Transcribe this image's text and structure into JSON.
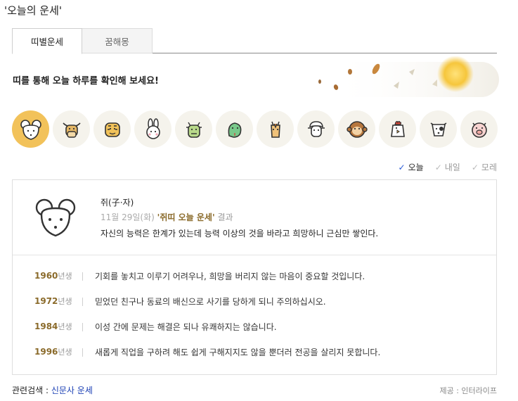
{
  "page_title": "'오늘의 운세'",
  "tabs": [
    {
      "label": "띠별운세",
      "active": true
    },
    {
      "label": "꿈해몽",
      "active": false
    }
  ],
  "headline": "띠를 통해 오늘 하루를 확인해 보세요!",
  "zodiac": [
    {
      "name": "rat",
      "selected": true
    },
    {
      "name": "ox",
      "selected": false
    },
    {
      "name": "tiger",
      "selected": false
    },
    {
      "name": "rabbit",
      "selected": false
    },
    {
      "name": "dragon",
      "selected": false
    },
    {
      "name": "snake",
      "selected": false
    },
    {
      "name": "horse",
      "selected": false
    },
    {
      "name": "sheep",
      "selected": false
    },
    {
      "name": "monkey",
      "selected": false
    },
    {
      "name": "rooster",
      "selected": false
    },
    {
      "name": "dog",
      "selected": false
    },
    {
      "name": "pig",
      "selected": false
    }
  ],
  "day_tabs": [
    {
      "label": "오늘",
      "active": true
    },
    {
      "label": "내일",
      "active": false
    },
    {
      "label": "모레",
      "active": false
    }
  ],
  "result": {
    "animal_name": "쥐(子·자)",
    "date": "11월 29일(화)",
    "link_text": "'쥐띠 오늘 운세'",
    "after_text": "결과",
    "summary": "자신의 능력은 한계가 있는데 능력 이상의 것을 바라고 희망하니 근심만 쌓인다."
  },
  "years": [
    {
      "year": "1960",
      "suffix": "년생",
      "text": "기회를 놓치고 이루기 어려우나, 희망을 버리지 않는 마음이 중요할 것입니다."
    },
    {
      "year": "1972",
      "suffix": "년생",
      "text": "믿었던 친구나 동료의 배신으로 사기를 당하게 되니 주의하십시오."
    },
    {
      "year": "1984",
      "suffix": "년생",
      "text": "이성 간에 문제는 해결은 되나 유쾌하지는 않습니다."
    },
    {
      "year": "1996",
      "suffix": "년생",
      "text": "새롭게 직업을 구하려 해도 쉽게 구해지지도 않을 뿐더러 전공을 살리지 못합니다."
    }
  ],
  "related": {
    "label": "관련검색 : ",
    "link": "신문사 운세"
  },
  "provider": "제공 : 인터라이프",
  "colors": {
    "selected_zodiac": "#f2c25a",
    "zodiac_bg": "#f5f3ec",
    "accent_brown": "#8a6a2a",
    "link_blue": "#1a3fb4"
  }
}
